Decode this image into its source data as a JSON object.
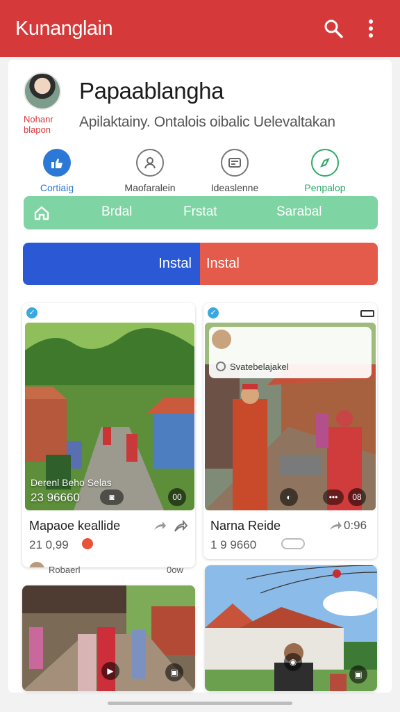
{
  "appbar": {
    "title": "Kunanglain",
    "search_icon": "search-icon",
    "more_icon": "more-vert-icon",
    "color": "#d6393a"
  },
  "profile": {
    "name": "Papaablangha",
    "subtitle": "Apilaktainy. Ontalois oibalic Uelevaltakan",
    "avatar_caption": "Nohanr blapon"
  },
  "categories": [
    {
      "label": "Cortiaig",
      "icon": "thumbs-up-icon",
      "color": "#2b78d6",
      "active": true
    },
    {
      "label": "Maofaralein",
      "icon": "person-circle-icon",
      "color": "#555555",
      "active": false
    },
    {
      "label": "Ideaslenne",
      "icon": "card-icon",
      "color": "#555555",
      "active": false
    },
    {
      "label": "Penpalop",
      "icon": "compass-icon",
      "color": "#2fa866",
      "active": false
    }
  ],
  "chips": {
    "home_icon": "home-icon",
    "items": [
      "Brdal",
      "Frstat",
      "Sarabal"
    ],
    "color": "#7fd4a3"
  },
  "install": {
    "left_label": "Instal",
    "right_label": "Instal",
    "left_color": "#2b59d6",
    "right_color": "#e45a4b"
  },
  "cards": [
    {
      "overlay_title": "Derenl Beho Selas",
      "overlay_number": "23 96660",
      "overlay_badge": "00",
      "title": "Mapaoe keallide",
      "price": "21 0,99",
      "author": "Robaerl",
      "meta": "0ow"
    },
    {
      "overlay_badge": "08",
      "title": "Narna Reide",
      "price": "1 9 9660",
      "count": "0:96",
      "popup_text": "Svatebelajakel"
    },
    {
      "title": ""
    },
    {
      "title": ""
    }
  ]
}
